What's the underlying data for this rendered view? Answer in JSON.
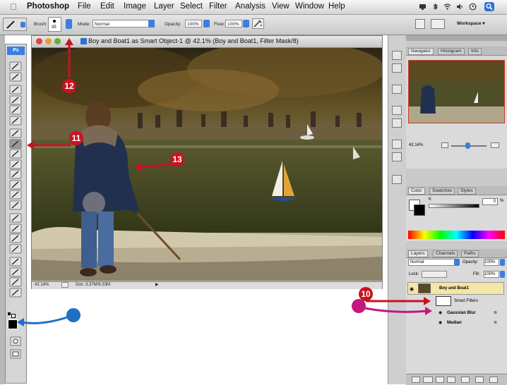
{
  "menubar": {
    "app": "Photoshop",
    "items": [
      "File",
      "Edit",
      "Image",
      "Layer",
      "Select",
      "Filter",
      "Analysis",
      "View",
      "Window",
      "Help"
    ]
  },
  "options": {
    "brush_label": "Brush:",
    "brush_size": "35",
    "mode_label": "Mode:",
    "mode_value": "Normal",
    "opacity_label": "Opacity:",
    "opacity_value": "100%",
    "flow_label": "Flow:",
    "flow_value": "100%",
    "workspace": "Workspace ▾"
  },
  "document": {
    "title": "Boy and Boat1 as Smart Object-1 @ 42.1% (Boy and Boat1, Filter Mask/8)",
    "zoom": "42.14%",
    "doc_size": "Doc: 3.37M/6.33M"
  },
  "navigator": {
    "tabs": [
      "Navigator",
      "Histogram",
      "Info"
    ],
    "zoom": "42.14%"
  },
  "color": {
    "tabs": [
      "Color",
      "Swatches",
      "Styles"
    ],
    "k_label": "K",
    "k_value": "0",
    "k_unit": "%"
  },
  "layers": {
    "tabs": [
      "Layers",
      "Channels",
      "Paths"
    ],
    "blend_mode": "Normal",
    "opacity_label": "Opacity:",
    "opacity_value": "100%",
    "lock_label": "Lock:",
    "fill_label": "Fill:",
    "fill_value": "100%",
    "layer_name": "Boy and Boat1",
    "smart_filters": "Smart Filters",
    "filters": [
      "Gaussian Blur",
      "Median"
    ]
  },
  "annotations": {
    "a10": "10",
    "a11": "11",
    "a12": "12",
    "a13": "13"
  },
  "colors": {
    "annotation_red": "#c81320",
    "arrow_blue": "#1f6fc5",
    "arrow_magenta": "#c2187f",
    "highlight_layer": "#f3e6a6"
  }
}
